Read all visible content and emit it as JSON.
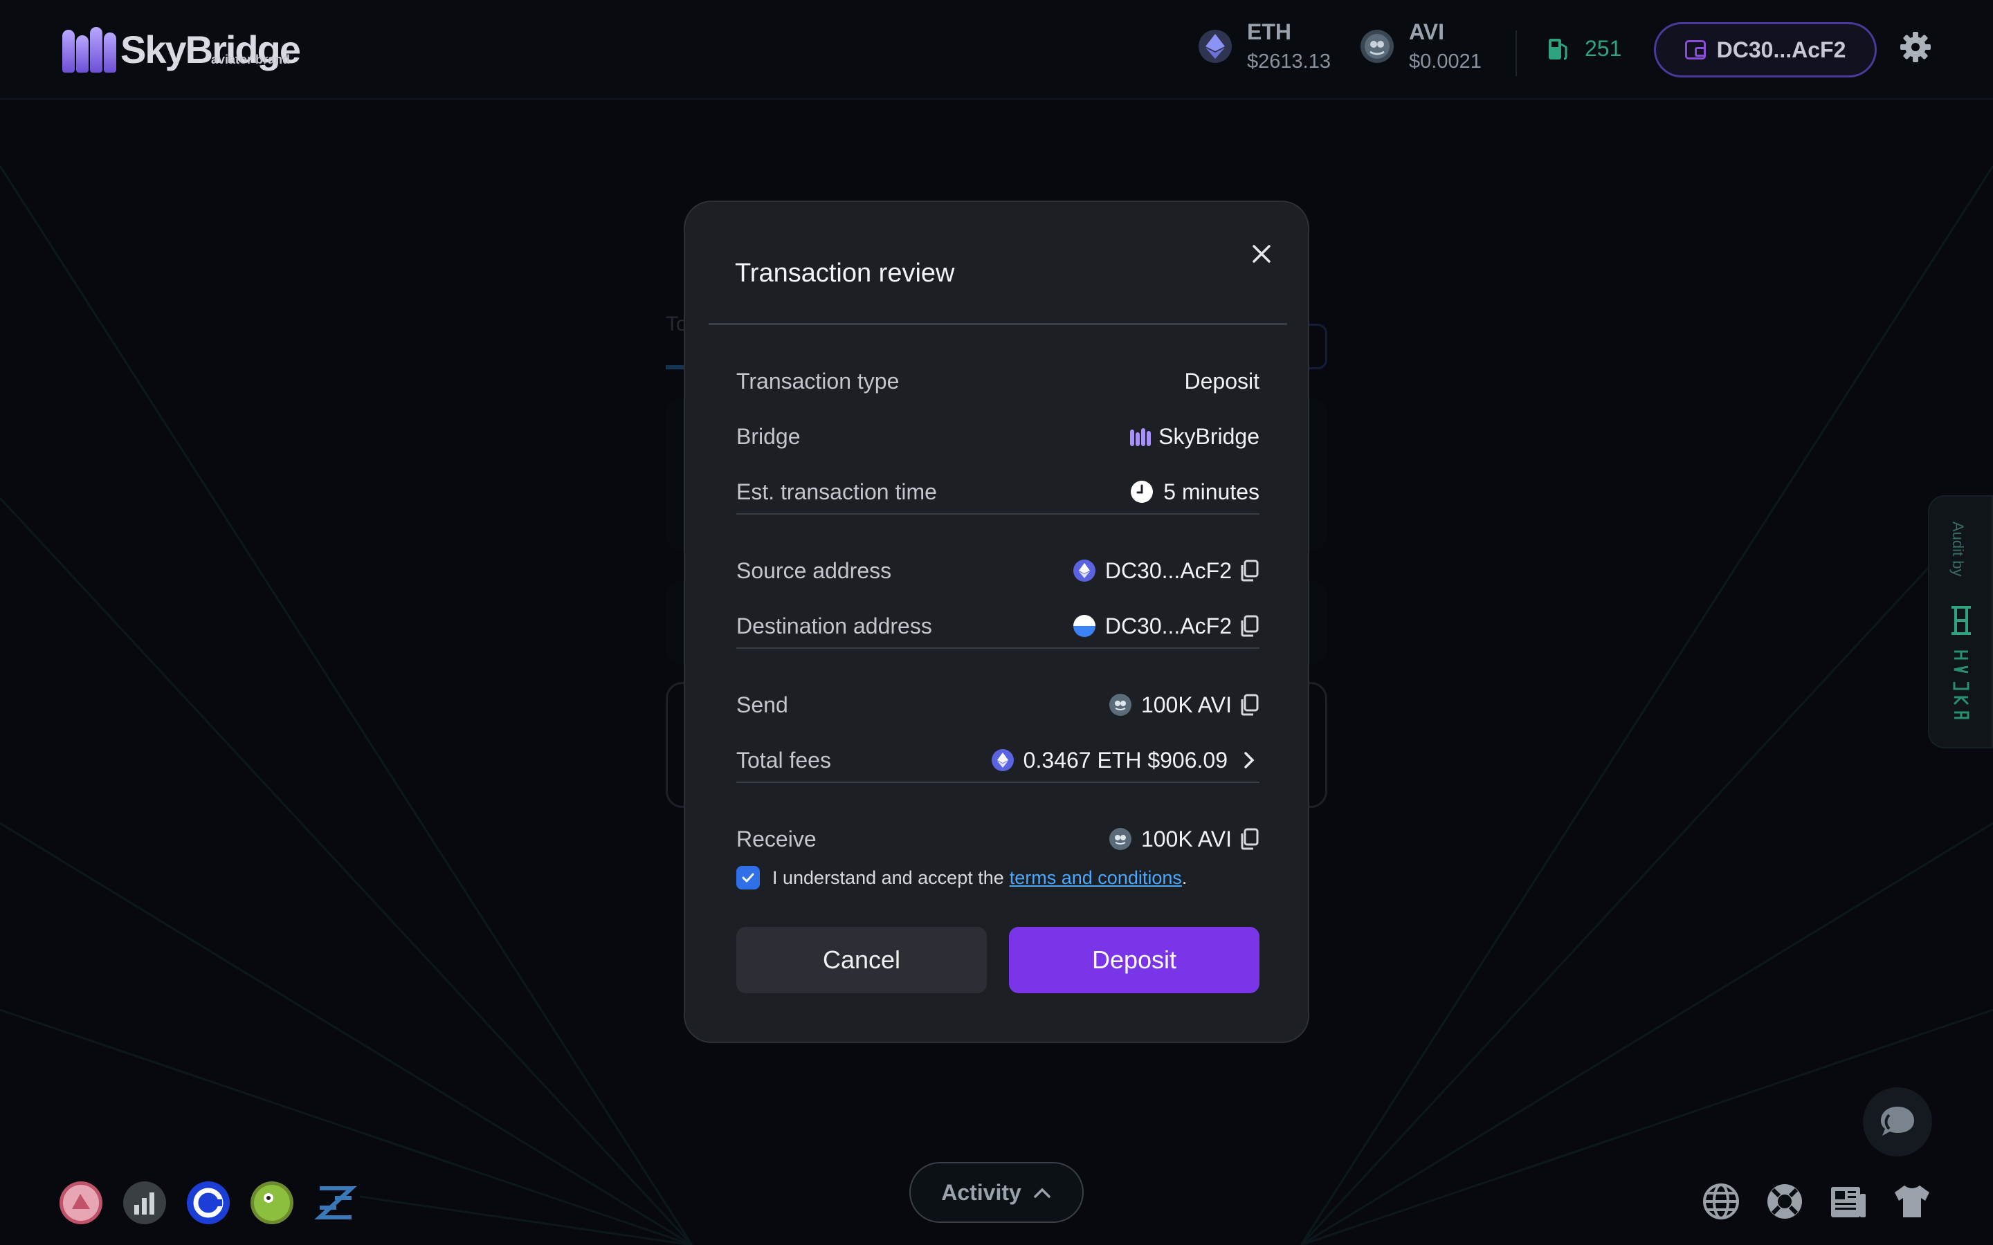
{
  "header": {
    "logo_text": "SkyBridge",
    "logo_subtext": "aviator brand",
    "tokens": [
      {
        "name": "ETH",
        "price": "$2613.13",
        "icon": "ethereum-icon"
      },
      {
        "name": "AVI",
        "price": "$0.0021",
        "icon": "avi-token-icon"
      }
    ],
    "gas_value": "251",
    "wallet_address": "DC30...AcF2"
  },
  "modal": {
    "title": "Transaction review",
    "rows": {
      "transaction_type": {
        "label": "Transaction type",
        "value": "Deposit"
      },
      "bridge": {
        "label": "Bridge",
        "value": "SkyBridge"
      },
      "est_time": {
        "label": "Est. transaction time",
        "value": "5 minutes"
      },
      "source_address": {
        "label": "Source address",
        "value": "DC30...AcF2"
      },
      "destination_address": {
        "label": "Destination address",
        "value": "DC30...AcF2"
      },
      "send": {
        "label": "Send",
        "value": "100K AVI"
      },
      "total_fees": {
        "label": "Total fees",
        "value": "0.3467 ETH $906.09"
      },
      "receive": {
        "label": "Receive",
        "value": "100K AVI"
      }
    },
    "terms_text": "I understand and accept the",
    "terms_link": "terms and conditions",
    "terms_suffix": ".",
    "terms_checked": true,
    "cancel_label": "Cancel",
    "deposit_label": "Deposit"
  },
  "footer": {
    "activity_label": "Activity",
    "audit_label": "Audit by"
  },
  "colors": {
    "accent": "#7b35e8",
    "link": "#4aa8ff",
    "checkbox": "#2f6fe8",
    "gas_green": "#2fa37d",
    "background": "#090d12",
    "modal": "#1c1f24"
  }
}
